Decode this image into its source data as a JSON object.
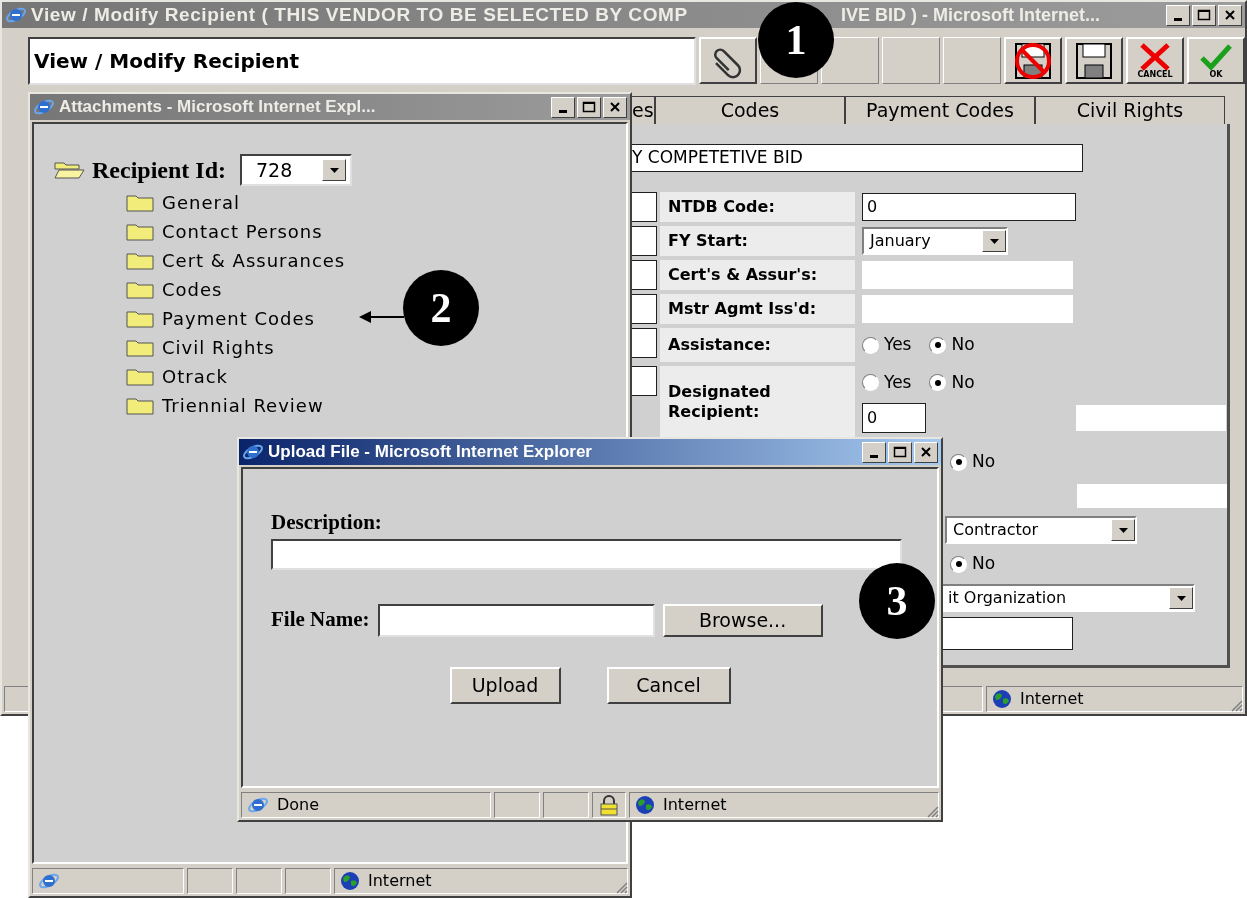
{
  "windows": {
    "main": {
      "title_parts": [
        "View / Modify Recipient ( THIS VENDOR TO BE SELECTED BY COMP",
        "IVE BID ) - Microsoft Internet..."
      ],
      "active": false,
      "header": {
        "title": "View / Modify Recipient",
        "toolbar": [
          {
            "kind": "attach"
          },
          {
            "kind": "empty"
          },
          {
            "kind": "empty"
          },
          {
            "kind": "empty"
          },
          {
            "kind": "empty"
          },
          {
            "kind": "no_save"
          },
          {
            "kind": "save"
          },
          {
            "kind": "cancel",
            "label": "CANCEL"
          },
          {
            "kind": "ok",
            "label": "OK"
          }
        ]
      },
      "tabs": [
        {
          "label": "es",
          "selected": false
        },
        {
          "label": "Codes",
          "selected": false
        },
        {
          "label": "Payment Codes",
          "selected": false
        },
        {
          "label": "Civil Rights",
          "selected": false
        }
      ],
      "form": {
        "banner": "Y COMPETETIVE BID",
        "rows": [
          {
            "kind": "text",
            "label": "NTDB Code:",
            "value": "0"
          },
          {
            "kind": "select",
            "label": "FY Start:",
            "value": "January"
          },
          {
            "kind": "plain",
            "label": "Cert's & Assur's:"
          },
          {
            "kind": "plain",
            "label": "Mstr Agmt Iss'd:"
          },
          {
            "kind": "radio",
            "label": "Assistance:",
            "options": [
              {
                "label": "Yes",
                "selected": false
              },
              {
                "label": "No",
                "selected": true
              }
            ]
          },
          {
            "kind": "radio_text",
            "label": "Designated Recipient:",
            "options": [
              {
                "label": "Yes",
                "selected": false
              },
              {
                "label": "No",
                "selected": true
              }
            ],
            "value": "0"
          }
        ],
        "partial_rows": [
          {
            "kind": "radio",
            "options": [
              {
                "label": "No",
                "selected": true
              }
            ]
          },
          {
            "kind": "plain"
          },
          {
            "kind": "select",
            "value": "Contractor"
          },
          {
            "kind": "radio",
            "options": [
              {
                "label": "No",
                "selected": true
              }
            ]
          },
          {
            "kind": "select",
            "value": "it Organization"
          },
          {
            "kind": "text"
          }
        ]
      },
      "status_bar": {
        "secure": false,
        "zone": "Internet"
      }
    },
    "attachments": {
      "title": "Attachments - Microsoft Internet Expl...",
      "active": false,
      "tree": {
        "label": "Recipient Id:",
        "value": "728",
        "expanded": true,
        "children": [
          {
            "label": "General"
          },
          {
            "label": "Contact Persons"
          },
          {
            "label": "Cert & Assurances"
          },
          {
            "label": "Codes"
          },
          {
            "label": "Payment Codes"
          },
          {
            "label": "Civil Rights"
          },
          {
            "label": "Otrack"
          },
          {
            "label": "Triennial Review"
          }
        ]
      },
      "status_bar": {
        "secure": false,
        "zone": "Internet"
      }
    },
    "upload": {
      "title": "Upload File - Microsoft Internet Explorer",
      "active": true,
      "description_label": "Description:",
      "file_label": "File Name:",
      "browse": "Browse...",
      "buttons": [
        "Upload",
        "Cancel"
      ],
      "status_bar": {
        "text": "Done",
        "secure": true,
        "zone": "Internet"
      }
    }
  },
  "callouts": [
    {
      "label": "1",
      "arrow": false
    },
    {
      "label": "2",
      "arrow": true
    },
    {
      "label": "3",
      "arrow": false
    }
  ]
}
